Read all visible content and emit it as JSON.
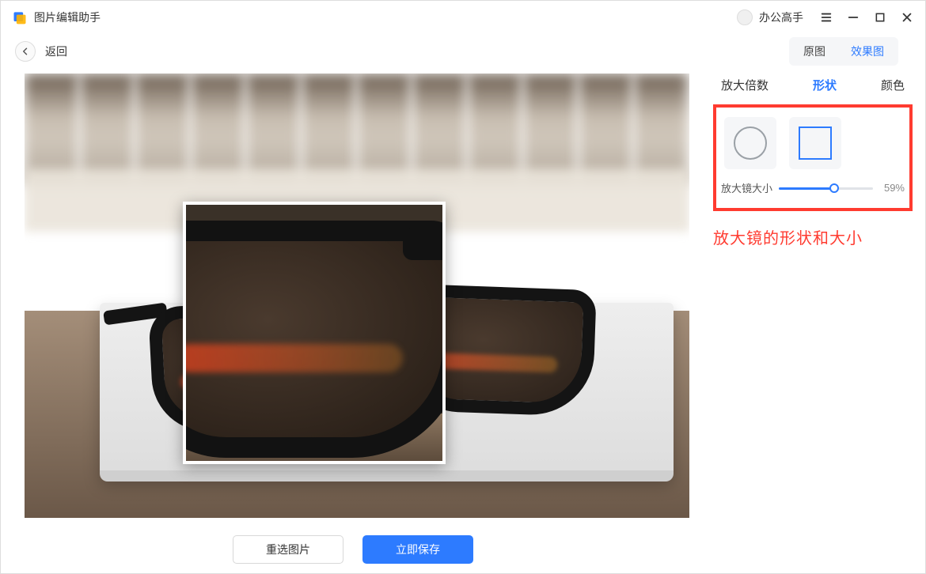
{
  "titlebar": {
    "app_title": "图片编辑助手",
    "user_label": "办公高手"
  },
  "toolbar": {
    "back_label": "返回",
    "view_toggle": {
      "original": "原图",
      "result": "效果图",
      "active": "result"
    }
  },
  "buttons": {
    "reselect": "重选图片",
    "save": "立即保存"
  },
  "side": {
    "tabs": {
      "zoom": "放大倍数",
      "shape": "形状",
      "color": "颜色",
      "active": "shape"
    },
    "slider": {
      "label": "放大镜大小",
      "value": 59,
      "display": "59%"
    }
  },
  "annotation": {
    "caption": "放大镜的形状和大小"
  }
}
